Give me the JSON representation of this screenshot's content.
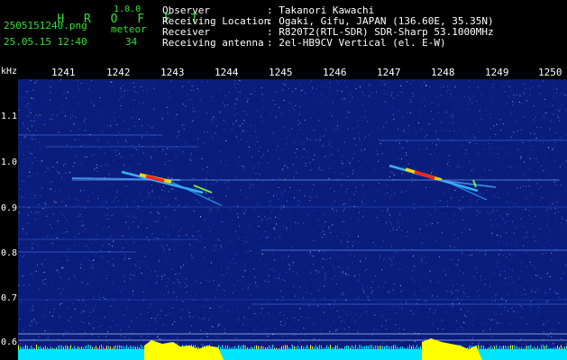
{
  "header": {
    "brand": "H R O F F T",
    "version": "1.0.0",
    "filename": "2505151240.png",
    "timestamp": "25.05.15 12:40",
    "meteor_label": "meteor",
    "meteor_count": "34",
    "fields": [
      {
        "label": "Observer",
        "value": ": Takanori Kawachi"
      },
      {
        "label": "Receiving Location",
        "value": ": Ogaki, Gifu, JAPAN (136.60E, 35.35N)"
      },
      {
        "label": "Receiver",
        "value": ": R820T2(RTL-SDR) SDR-Sharp 53.1000MHz"
      },
      {
        "label": "Receiving antenna",
        "value": ": 2el-HB9CV Vertical (el. E-W)"
      }
    ]
  },
  "axis": {
    "unit": "kHz",
    "minute_ticks": [
      "1241",
      "1242",
      "1243",
      "1244",
      "1245",
      "1246",
      "1247",
      "1248",
      "1249",
      "1250"
    ],
    "freq_ticks": [
      "1.1",
      "1.0",
      "0.9",
      "0.8",
      "0.7",
      "0.6"
    ]
  },
  "colors": {
    "background": "#0a1d7c",
    "label_green": "#34e034",
    "text": "#ffffff",
    "bottom_bar_yellow": "#ffff00",
    "bottom_bar_cyan": "#00e5ff",
    "echo_red": "#ff2020"
  }
}
